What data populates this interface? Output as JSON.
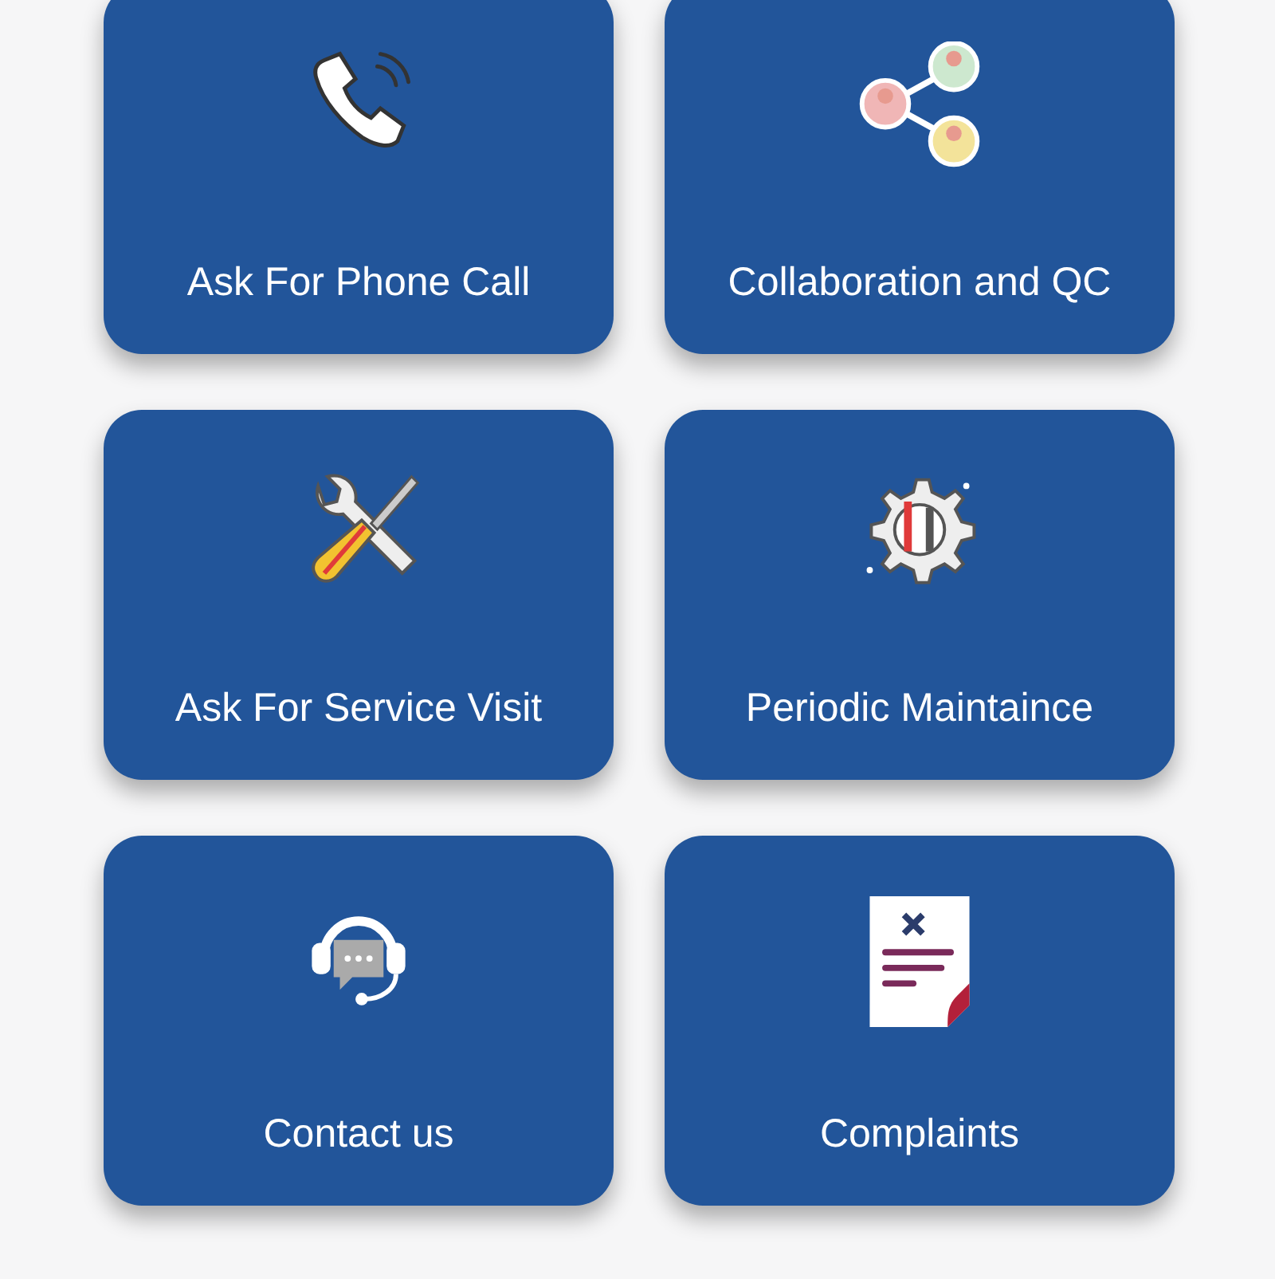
{
  "tiles": [
    {
      "label": "Ask For Phone Call",
      "kind": "phone"
    },
    {
      "label": "Collaboration and QC",
      "kind": "share"
    },
    {
      "label": "Ask For Service Visit",
      "kind": "tools"
    },
    {
      "label": "Periodic Maintaince",
      "kind": "gear"
    },
    {
      "label": "Contact us",
      "kind": "headset"
    },
    {
      "label": "Complaints",
      "kind": "document"
    }
  ]
}
